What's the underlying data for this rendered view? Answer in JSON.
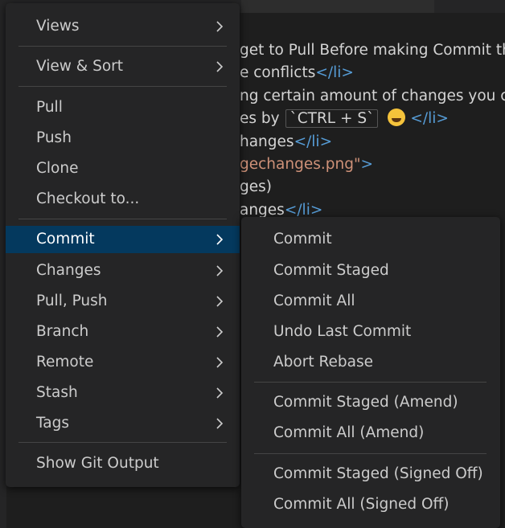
{
  "editor": {
    "lines": [
      {
        "pre": "get to Pull Before making Commit th",
        "tag": "",
        "str": ""
      },
      {
        "pre": "e conflicts",
        "tag": "</li>",
        "str": ""
      },
      {
        "pre": "ng certain amount of changes you ca",
        "tag": "",
        "str": ""
      },
      {
        "pre": "es by ",
        "code": "`CTRL + S`",
        "tag": "</li>",
        "str": ""
      },
      {
        "pre": "hanges",
        "tag": "</li>",
        "str": ""
      },
      {
        "pre": "",
        "tag": "",
        "str": "gechanges.png\""
      },
      {
        "pre": "ges)",
        "tag": "",
        "str": ""
      },
      {
        "pre": "anges",
        "tag": "</li>",
        "str": ""
      }
    ],
    "close_bracket": ">"
  },
  "main_menu": {
    "items": [
      {
        "label": "Views"
      },
      {
        "label": "View & Sort"
      },
      {
        "label": "Pull"
      },
      {
        "label": "Push"
      },
      {
        "label": "Clone"
      },
      {
        "label": "Checkout to..."
      },
      {
        "label": "Commit"
      },
      {
        "label": "Changes"
      },
      {
        "label": "Pull, Push"
      },
      {
        "label": "Branch"
      },
      {
        "label": "Remote"
      },
      {
        "label": "Stash"
      },
      {
        "label": "Tags"
      },
      {
        "label": "Show Git Output"
      }
    ]
  },
  "commit_submenu": {
    "items": [
      {
        "label": "Commit"
      },
      {
        "label": "Commit Staged"
      },
      {
        "label": "Commit All"
      },
      {
        "label": "Undo Last Commit"
      },
      {
        "label": "Abort Rebase"
      },
      {
        "label": "Commit Staged (Amend)"
      },
      {
        "label": "Commit All (Amend)"
      },
      {
        "label": "Commit Staged (Signed Off)"
      },
      {
        "label": "Commit All (Signed Off)"
      }
    ]
  },
  "colors": {
    "menu_bg": "#252526",
    "active_bg": "#04395e",
    "text": "#cccccc",
    "separator": "#454545"
  }
}
